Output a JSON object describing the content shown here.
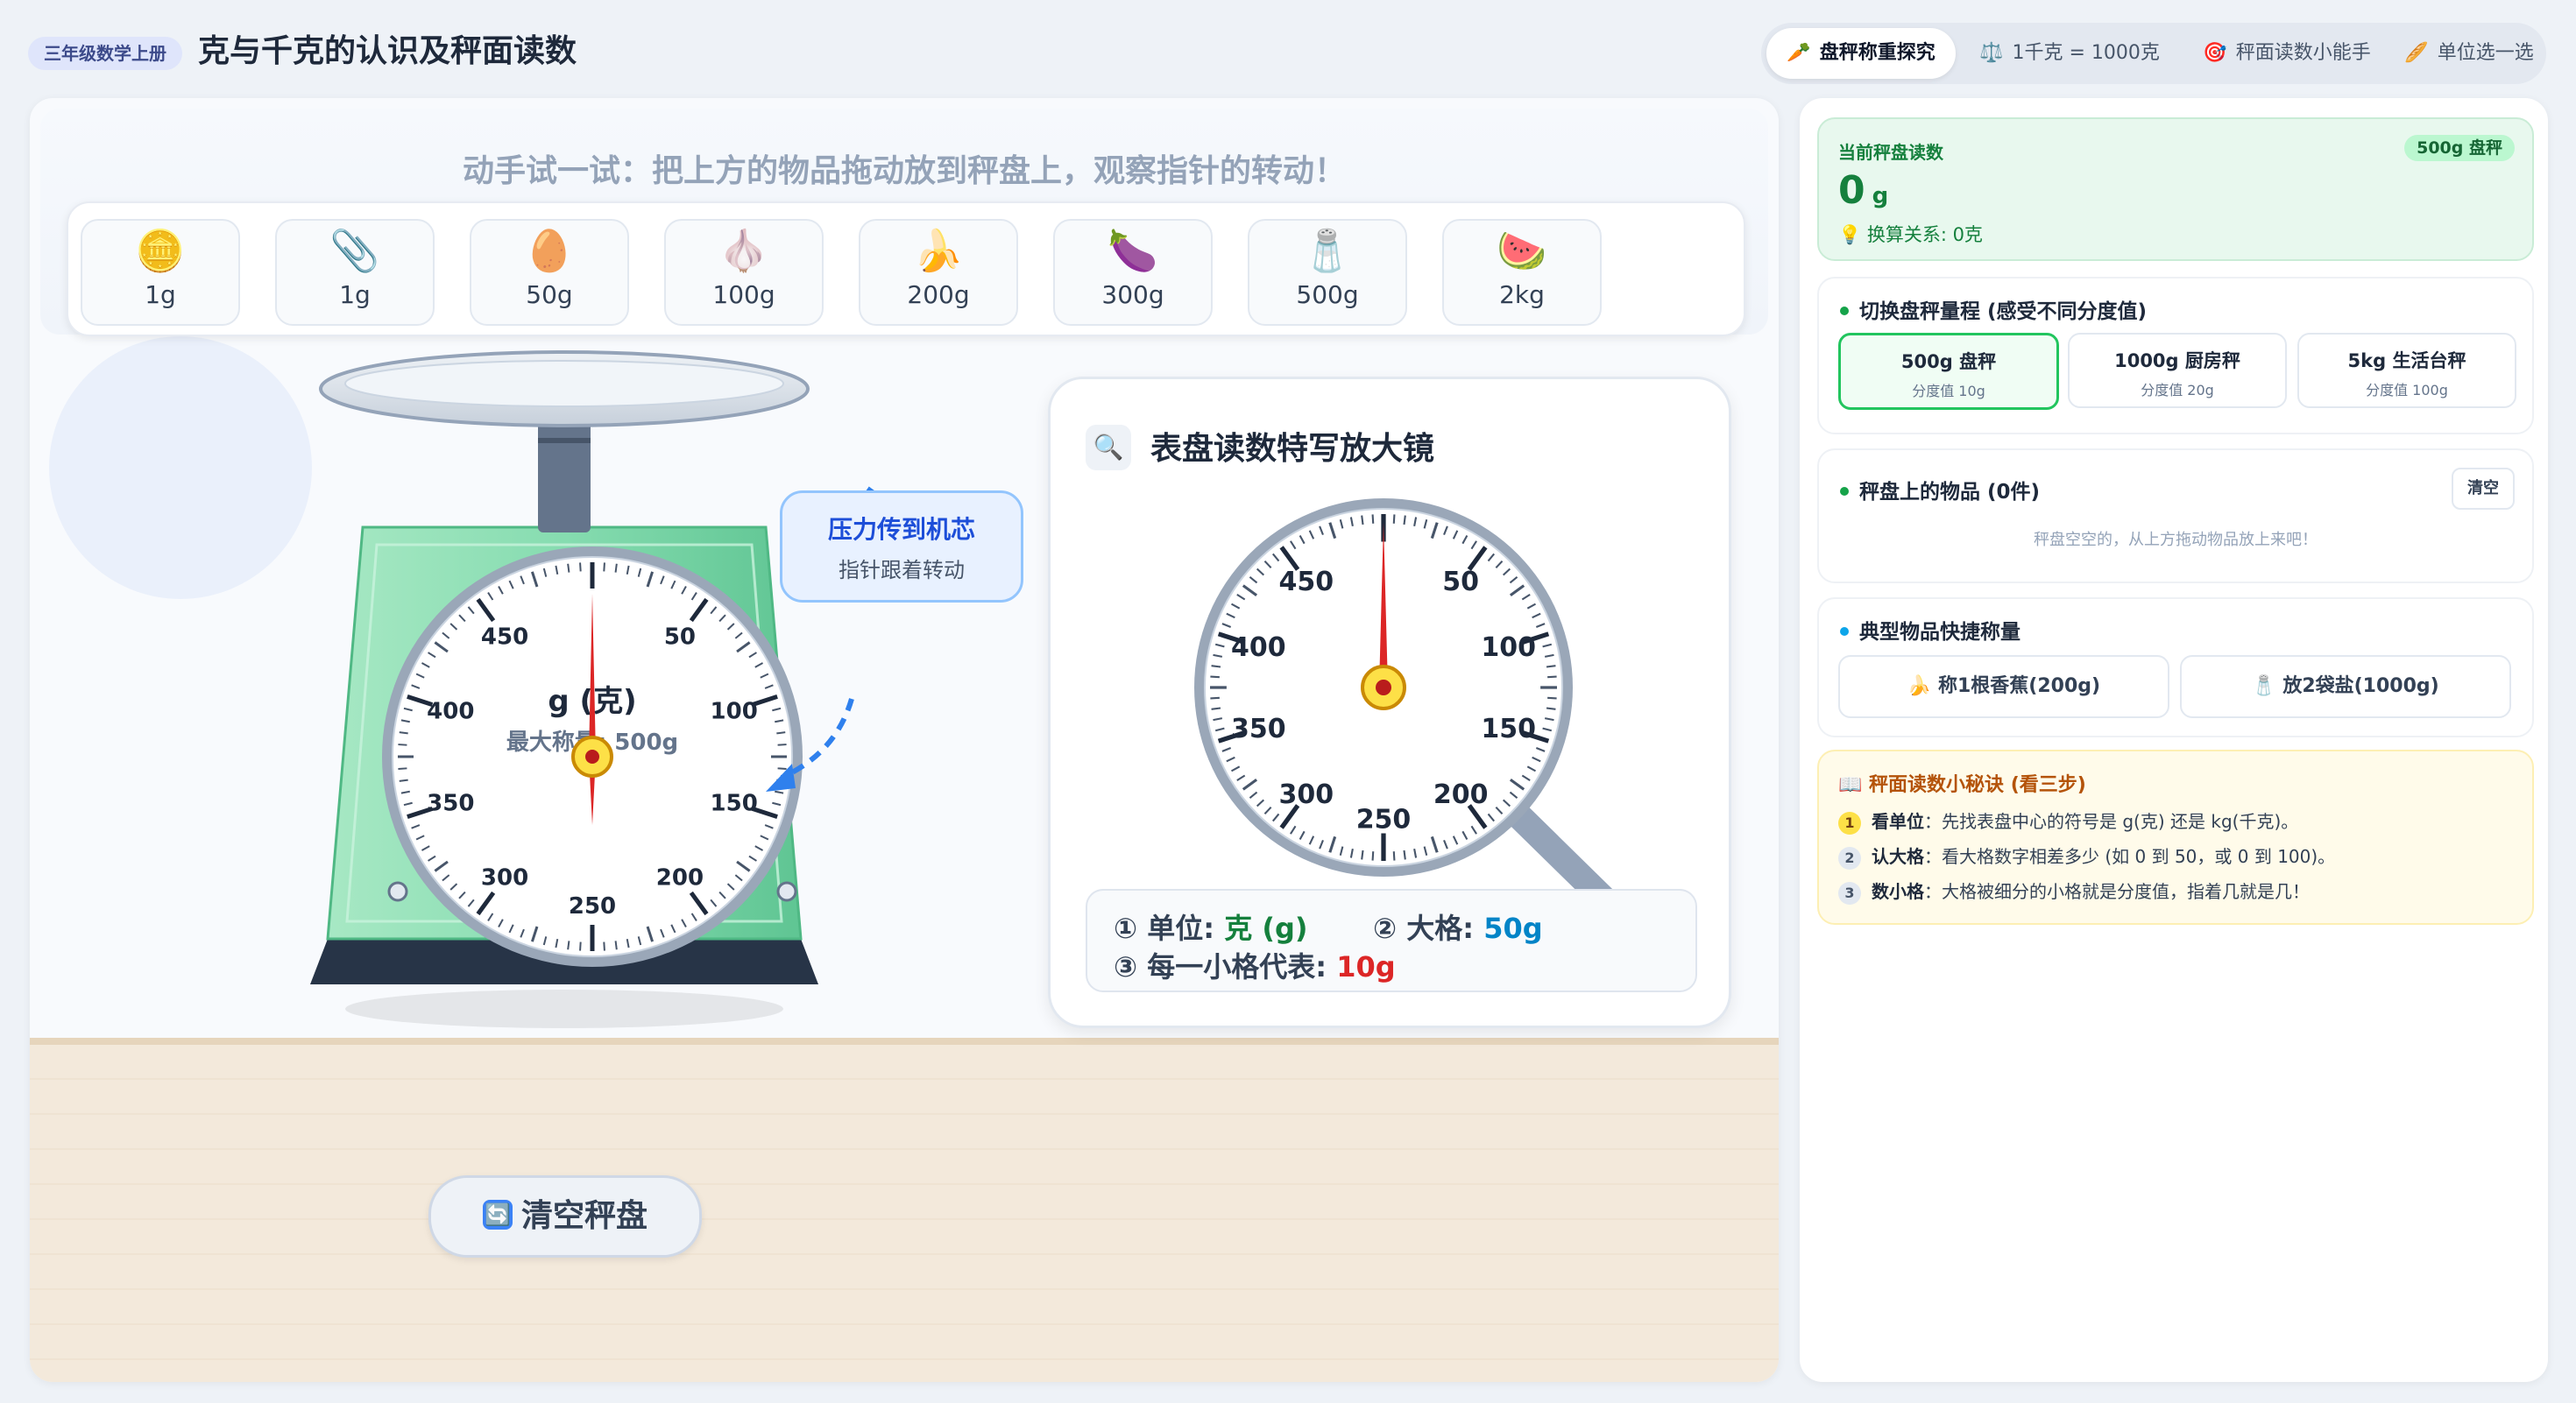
{
  "header": {
    "grade_badge": "三年级数学上册",
    "title": "克与千克的认识及秤面读数",
    "tabs": [
      {
        "icon": "🥕",
        "label": "盘秤称重探究",
        "active": true
      },
      {
        "icon": "⚖️",
        "label": "1千克 = 1000克",
        "active": false
      },
      {
        "icon": "🎯",
        "label": "秤面读数小能手",
        "active": false
      },
      {
        "icon": "🥖",
        "label": "单位选一选",
        "active": false
      }
    ]
  },
  "stage": {
    "instruction": "动手试一试：把上方的物品拖动放到秤盘上，观察指针的转动！",
    "items": [
      {
        "icon": "🪙",
        "icon_name": "coin-icon",
        "weight": "1g"
      },
      {
        "icon": "📎",
        "icon_name": "paperclip-icon",
        "weight": "1g"
      },
      {
        "icon": "🥚",
        "icon_name": "egg-icon",
        "weight": "50g"
      },
      {
        "icon": "🧄",
        "icon_name": "garlic-icon",
        "weight": "100g"
      },
      {
        "icon": "🍌",
        "icon_name": "banana-icon",
        "weight": "200g"
      },
      {
        "icon": "🍆",
        "icon_name": "eggplant-icon",
        "weight": "300g"
      },
      {
        "icon": "🧂",
        "icon_name": "salt-icon",
        "weight": "500g"
      },
      {
        "icon": "🍉",
        "icon_name": "watermelon-icon",
        "weight": "2kg"
      }
    ],
    "dial": {
      "unit_label": "g (克)",
      "max_label": "最大称量: 500g",
      "numbers": [
        "50",
        "100",
        "150",
        "200",
        "250",
        "300",
        "350",
        "400",
        "450"
      ],
      "max": 500,
      "reading": 0
    },
    "callout": {
      "title": "压力传到机芯",
      "subtitle": "指针跟着转动"
    },
    "clear_button": {
      "icon": "🔄",
      "label": "清空秤盘"
    },
    "magnifier": {
      "icon": "🔍",
      "title": "表盘读数特写放大镜",
      "unit_prefix": "① 单位: ",
      "unit_value": "克 (g)",
      "big_prefix": "② 大格: ",
      "big_value": "50g",
      "small_prefix": "③ 每一小格代表: ",
      "small_value": "10g"
    }
  },
  "sidebar": {
    "reading": {
      "label": "当前秤盘读数",
      "scale_tag": "500g 盘秤",
      "value": "0",
      "unit": "g",
      "conversion": "💡 换算关系:  0克"
    },
    "ranges": {
      "title": "切换盘秤量程 (感受不同分度值)",
      "options": [
        {
          "name": "500g 盘秤",
          "step": "分度值 10g",
          "active": true
        },
        {
          "name": "1000g 厨房秤",
          "step": "分度值 20g",
          "active": false
        },
        {
          "name": "5kg 生活台秤",
          "step": "分度值 100g",
          "active": false
        }
      ]
    },
    "on_scale": {
      "title": "秤盘上的物品 (0件)",
      "clear_label": "清空",
      "empty_text": "秤盘空空的，从上方拖动物品放上来吧！"
    },
    "quick": {
      "title": "典型物品快捷称量",
      "buttons": [
        "🍌 称1根香蕉(200g)",
        "🧂 放2袋盐(1000g)"
      ]
    },
    "tips": {
      "title": "📖 秤面读数小秘诀 (看三步)",
      "items": [
        {
          "n": "1",
          "bold": "看单位",
          "text": "：先找表盘中心的符号是 g(克) 还是 kg(千克)。"
        },
        {
          "n": "2",
          "bold": "认大格",
          "text": "：看大格数字相差多少 (如 0 到 50，或 0 到 100)。"
        },
        {
          "n": "3",
          "bold": "数小格",
          "text": "：大格被细分的小格就是分度值，指着几就是几！"
        }
      ]
    }
  },
  "colors": {
    "scale_body": "#7dd3a6",
    "needle": "#dc2626",
    "accent_green": "#16a34a",
    "accent_blue": "#1d4ed8"
  }
}
